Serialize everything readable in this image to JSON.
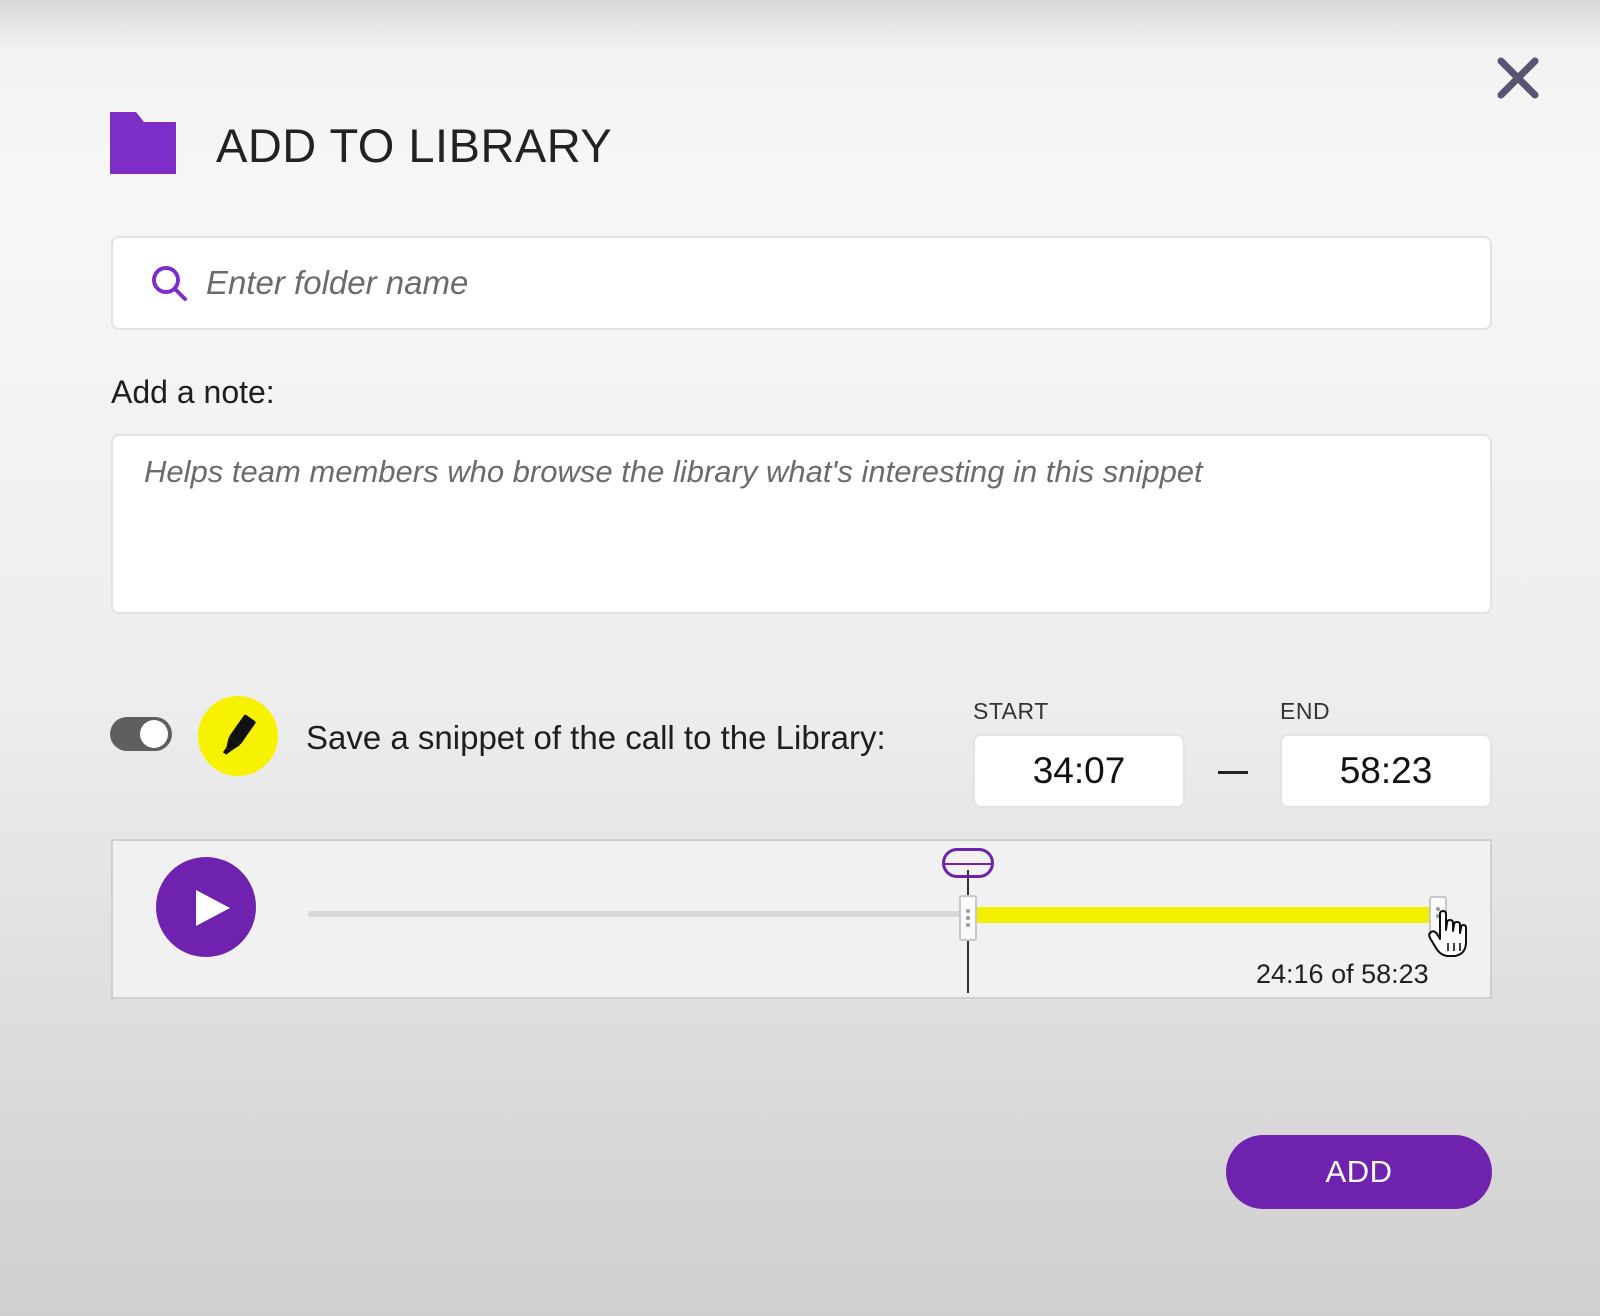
{
  "dialog": {
    "title": "ADD TO LIBRARY"
  },
  "search": {
    "placeholder": "Enter folder name",
    "value": ""
  },
  "note": {
    "label": "Add a note:",
    "placeholder": "Helps team members who browse the library what's interesting in this snippet",
    "value": ""
  },
  "snippet": {
    "toggle_on": true,
    "label": "Save a snippet of the call to the Library:",
    "start_label": "START",
    "end_label": "END",
    "start_value": "34:07",
    "end_value": "58:23"
  },
  "player": {
    "time_readout": "24:16 of 58:23",
    "range_start_fraction": 0.584,
    "range_end_fraction": 1.0,
    "playhead_fraction": 0.584
  },
  "actions": {
    "add_label": "ADD"
  },
  "colors": {
    "accent": "#6e22ad",
    "highlight": "#f2ef00",
    "toggle": "#5f5f5f"
  },
  "icons": {
    "close": "close-icon",
    "folder": "folder-icon",
    "search": "search-icon",
    "highlighter": "highlighter-icon",
    "play": "play-icon",
    "cursor": "hand-cursor-icon"
  }
}
